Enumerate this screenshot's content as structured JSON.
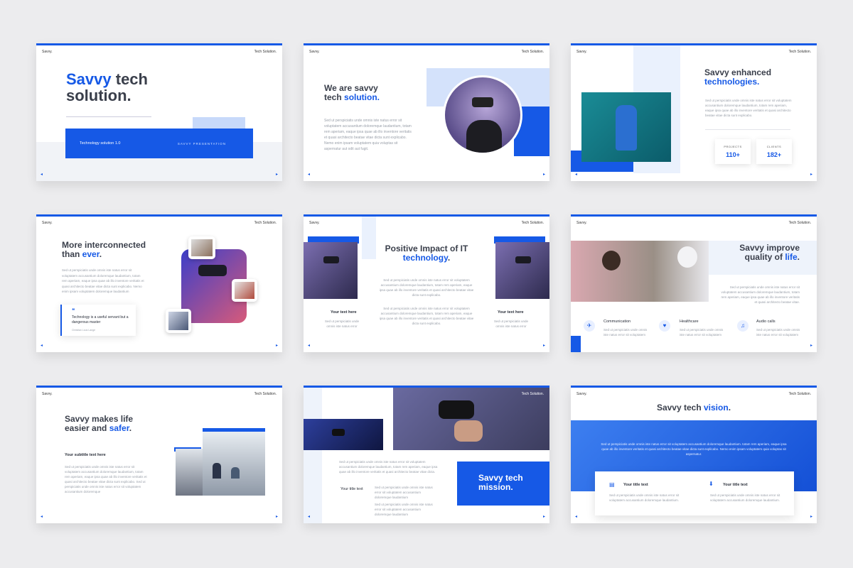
{
  "brand": "Savvy.",
  "tagline": "Tech Solution.",
  "nav": {
    "prev": "◂",
    "next": "▸"
  },
  "slide1": {
    "title_blue": "Savvy",
    "title_rest": " tech",
    "title_line2": "solution.",
    "band_left": "Technology solution 1.0",
    "band_right": "SAVVY PRESENTATION"
  },
  "slide2": {
    "title_l1": "We are savvy",
    "title_l2a": "tech ",
    "title_l2b": "solution.",
    "body": "Sed ut perspiciatis unde omnis iste natus error sit voluptatem accusantium doloremque laudantium, totam rem aperiam, eaque ipsa quae ab illo inventore veritatis et quasi architecto beatae vitae dicta sunt explicabo. Nemo enim ipsam voluptatem quia voluptas sit aspernatur aut odit aut fugit."
  },
  "slide3": {
    "title_l1": "Savvy enhanced",
    "title_l2": "technologies",
    "title_dot": ".",
    "body": "Sed ut perspiciatis unde omnis iste natus error sit voluptatem accusantium doloremque laudantium, totam rem aperiam, eaque ipsa quae ab illo inventore veritatis et quasi architecto beatae vitae dicta sunt explicabo.",
    "stats": [
      {
        "label": "PROJECTS",
        "value": "110+"
      },
      {
        "label": "CLIENTS",
        "value": "182+"
      }
    ]
  },
  "slide4": {
    "title_l1": "More interconnected",
    "title_l2a": "than ",
    "title_l2b": "ever",
    "title_dot": ".",
    "body": "Sed ut perspiciatis unde omnis iste natus error sit voluptatem accusantium doloremque laudantium, totam rem aperiam, eaque ipsa quae ab illo inventore veritatis et quasi architecto beatae vitae dicta sunt explicabo. Nemo enim ipsam voluptatem doloremque laudantium",
    "quote_mark": "❝",
    "quote": "Technology is a useful servant but a dangerous master",
    "quote_author": "Christian Lous Lange"
  },
  "slide5": {
    "title_l1": "Positive Impact of IT",
    "title_l2": "technology",
    "title_dot": ".",
    "body1": "Sed ut perspiciatis unde omnis iste natus error sit voluptatem accusantium doloremque laudantium, totam rem aperiam, eaque ipsa quae ab illo inventore veritatis et quasi architecto beatae vitae dicta sunt explicabo.",
    "body2": "Sed ut perspiciatis unde omnis iste natus error sit voluptatem accusantium doloremque laudantium, totam rem aperiam, eaque ipsa quae ab illo inventore veritatis et quasi architecto beatae vitae dicta sunt explicabo.",
    "left_label": "Your text here",
    "left_body": "Sed ut perspiciatis unde omnis iste natus error",
    "right_label": "Your text here",
    "right_body": "Sed ut perspiciatis unde omnis iste natus error"
  },
  "slide6": {
    "title_l1": "Savvy improve",
    "title_l2a": "quality of ",
    "title_l2b": "life",
    "title_dot": ".",
    "body": "Sed ut perspiciatis unde omnis iste natus error sit voluptatem accusantium doloremque laudantium, totam rem aperiam, eaque ipsa quae ab illo inventore veritatis et quasi architecto beatae vitae.",
    "features": [
      {
        "name": "Communication",
        "body": "Sed ut perspiciatis unde omnis iste natus error sit voluptatem"
      },
      {
        "name": "Healthcare",
        "body": "Sed ut perspiciatis unde omnis iste natus error sit voluptatem"
      },
      {
        "name": "Audio calls",
        "body": "Sed ut perspiciatis unde omnis iste natus error sit voluptatem"
      }
    ]
  },
  "slide7": {
    "title_l1": "Savvy makes life",
    "title_l2a": "easier and ",
    "title_l2b": "safer",
    "title_dot": ".",
    "subtitle": "Your subtitle text here",
    "body": "Sed ut perspiciatis unde omnis iste natus error sit voluptatem accusantium doloremque laudantium, totam rem aperiam, eaque ipsa quae ab illo inventore veritatis et quasi architecto beatae vitae dicta sunt explicabo. Sed ut perspiciatis unde omnis iste natus error sit voluptatem accusantium doloremque"
  },
  "slide8": {
    "body": "Sed ut perspiciatis unde omnis iste natus error sit voluptatem accusantium doloremque laudantium, totam rem aperiam, eaque ipsa quae ab illo inventore veritatis et quasi architecto beatae vitae dicta.",
    "label": "Your title text",
    "body2": "Sed ut perspiciatis unde omnis iste natus error sit voluptatem accusantium doloremque laudantium",
    "body3": "Sed ut perspiciatis unde omnis iste natus error sit voluptatem accusantium doloremque laudantium",
    "box_l1": "Savvy tech",
    "box_l2": "mission."
  },
  "slide9": {
    "title_a": "Savvy tech ",
    "title_b": "vision",
    "title_dot": ".",
    "body": "Sed ut perspiciatis unde omnis iste natus error sit voluptatem accusantium doloremque laudantium. totam rem aperiam, eaque ipsa quae ab illo inventore veritatis et quasi architecto beatae vitae dicta sunt explicabo. Nemo enim ipsam voluptatem quia voluptas sit aspernatur.",
    "cards": [
      {
        "title": "Your title text",
        "body": "Sed ut perspiciatis unde omnis iste natus error sit voluptatem accusantium doloremque laudantium."
      },
      {
        "title": "Your title text",
        "body": "Sed ut perspiciatis unde omnis iste natus error sit voluptatem accusantium doloremque laudantium."
      }
    ]
  },
  "colors": {
    "accent": "#1659e6",
    "title": "#3a3f4b",
    "muted": "#9aa0aa",
    "light_blue": "#d4e2fb"
  }
}
